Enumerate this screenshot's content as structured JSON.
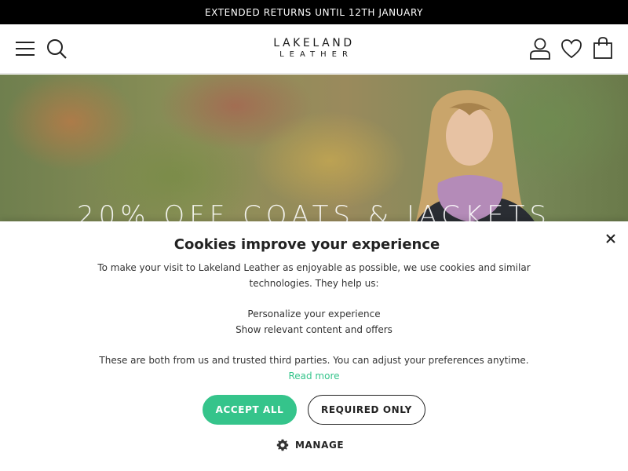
{
  "promo_bar": {
    "text": "EXTENDED RETURNS UNTIL 12TH JANUARY"
  },
  "header": {
    "logo_top": "LAKELAND",
    "logo_bottom": "LEATHER",
    "icons": [
      "menu-icon",
      "search-icon",
      "account-icon",
      "heart-icon",
      "bag-icon"
    ]
  },
  "hero": {
    "headline": "20% OFF COATS & JACKETS"
  },
  "cookie_banner": {
    "title": "Cookies improve your experience",
    "intro": "To make your visit to Lakeland Leather as enjoyable as possible, we use cookies and similar technologies. They help us:",
    "benefits": [
      "Personalize your experience",
      "Show relevant content and offers"
    ],
    "note": "These are both from us and trusted third parties. You can adjust your preferences anytime.",
    "read_more": "Read more",
    "accept_label": "ACCEPT ALL",
    "required_label": "REQUIRED ONLY",
    "manage_label": "MANAGE",
    "accent_color": "#35c48b"
  }
}
